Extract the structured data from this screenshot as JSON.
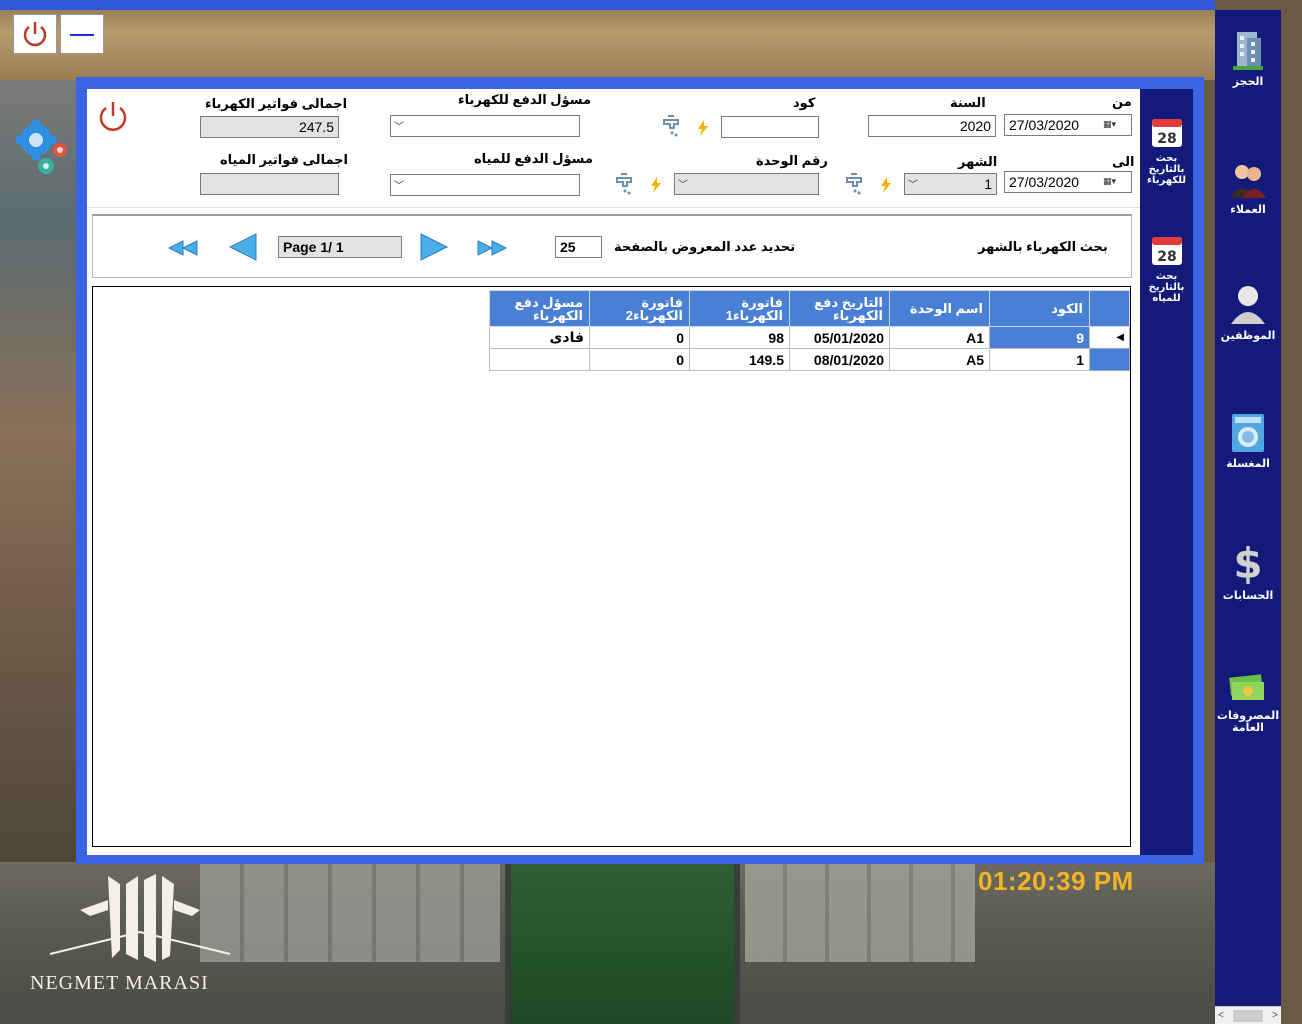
{
  "nav": {
    "items": [
      {
        "label": "الحجز",
        "icon": "building-icon"
      },
      {
        "label": "العملاء",
        "icon": "customers-icon"
      },
      {
        "label": "الموظفين",
        "icon": "employee-icon"
      },
      {
        "label": "المغسلة",
        "icon": "washing-machine-icon"
      },
      {
        "label": "الحسابات",
        "icon": "dollar-icon"
      },
      {
        "label": "المصروفات العامة",
        "icon": "money-icon"
      }
    ]
  },
  "side_nav": {
    "electric_date_search": "بحث بالتاريخ للكهرباء",
    "water_date_search": "بحث بالتاريخ للمياه",
    "calendar_day": "28"
  },
  "filters": {
    "from_label": "من",
    "to_label": "الى",
    "from_date": "27/03/2020",
    "to_date": "27/03/2020",
    "year_label": "السنة",
    "year_value": "2020",
    "month_label": "الشهر",
    "month_value": "1",
    "code_label": "كود",
    "code_value": "",
    "unit_label": "رقم الوحدة",
    "unit_value": "",
    "electric_payer_label": "مسؤل الدفع للكهرباء",
    "water_payer_label": "مسؤل الدفع للمياه",
    "total_electric_label": "اجمالى فواتير الكهرباء",
    "total_electric_value": "247.5",
    "total_water_label": "اجمالى فواتير المياه",
    "total_water_value": ""
  },
  "pager": {
    "page_text": "Page 1/ 1",
    "page_size": "25",
    "page_size_label": "تحديد عدد المعروض بالصفحة",
    "search_mode_label": "بحث الكهرباء بالشهر"
  },
  "grid": {
    "headers": [
      "الكود",
      "اسم الوحدة",
      "التاريخ دفع الكهرباء",
      "فاتورة الكهرباء1",
      "فاتورة الكهرباء2",
      "مسؤل دفع الكهرباء"
    ],
    "rows": [
      [
        "9",
        "A1",
        "05/01/2020",
        "98",
        "0",
        "فادى"
      ],
      [
        "1",
        "A5",
        "08/01/2020",
        "149.5",
        "0",
        ""
      ]
    ]
  },
  "clock": "01:20:39 PM",
  "brand": "NEGMET MARASI",
  "colors": {
    "frame": "#3b63e6",
    "nav": "#141a7a",
    "header": "#4a7fd6",
    "clock": "#f3b526"
  }
}
